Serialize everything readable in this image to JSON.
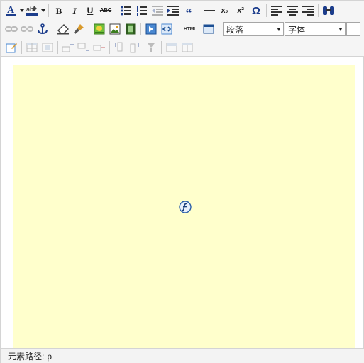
{
  "toolbar": {
    "row1": {
      "font_color_icon": "font-color-icon",
      "bold": "B",
      "italic": "I",
      "underline": "U",
      "strike": "ABC",
      "blockquote": "“",
      "subscript": "x₂",
      "superscript": "x²",
      "special_chars": "Ω"
    },
    "row2": {
      "html_source": "HTML",
      "paragraph_select": "段落",
      "font_select": "字体"
    }
  },
  "status": {
    "label": "元素路径:",
    "path": "p"
  },
  "colors": {
    "content_bg": "#ffffcc",
    "toolbar_bg": "#f5f5f5",
    "border": "#d4d4d4"
  }
}
